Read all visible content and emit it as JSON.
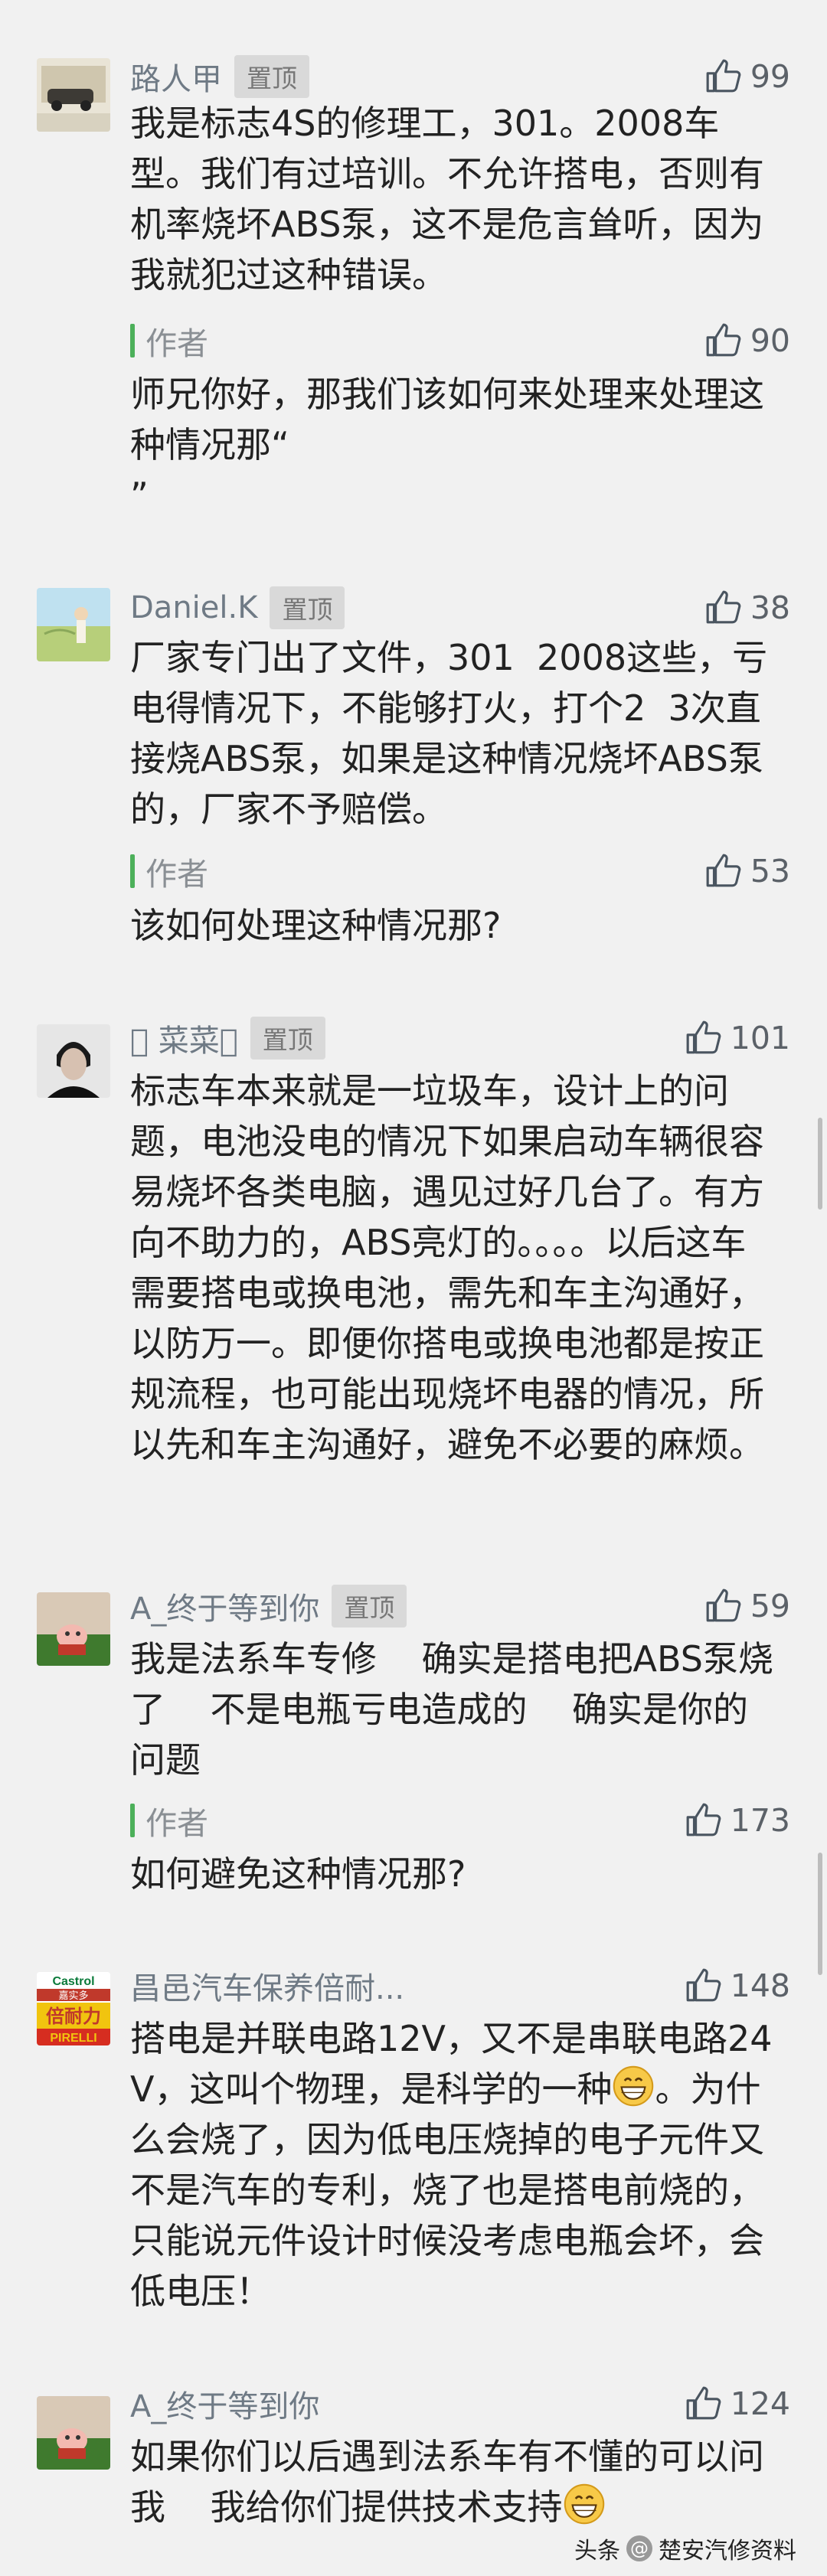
{
  "comments": [
    {
      "username": "路人甲",
      "pinned_label": "置顶",
      "likes": "99",
      "text": "我是标志4S的修理工，301。2008车型。我们有过培训。不允许搭电，否则有机率烧坏ABS泵，这不是危言耸听，因为我就犯过这种错误。",
      "reply": {
        "label": "作者",
        "likes": "90",
        "text": "师兄你好，那我们该如何来处理来处理这种情况那“\n”"
      }
    },
    {
      "username": "Daniel.K",
      "pinned_label": "置顶",
      "likes": "38",
      "text": "厂家专门出了文件，301  2008这些，亏电得情况下，不能够打火，打个2  3次直接烧ABS泵，如果是这种情况烧坏ABS泵的，厂家不予赔偿。",
      "reply": {
        "label": "作者",
        "likes": "53",
        "text": "该如何处理这种情况那?"
      }
    },
    {
      "username": "\u0000 菜菜\u0000",
      "pinned_label": "置顶",
      "likes": "101",
      "text": "标志车本来就是一垃圾车，设计上的问题，电池没电的情况下如果启动车辆很容易烧坏各类电脑，遇见过好几台了。有方向不助力的，ABS亮灯的。。。。以后这车需要搭电或换电池，需先和车主沟通好，以防万一。即便你搭电或换电池都是按正规流程，也可能出现烧坏电器的情况，所以先和车主沟通好，避免不必要的麻烦。"
    },
    {
      "username": "A_终于等到你",
      "pinned_label": "置顶",
      "likes": "59",
      "text": "我是法系车专修    确实是搭电把ABS泵烧了    不是电瓶亏电造成的    确实是你的问题",
      "reply": {
        "label": "作者",
        "likes": "173",
        "text": "如何避免这种情况那?"
      }
    },
    {
      "username": "昌邑汽车保养倍耐...",
      "likes": "148",
      "text_before_emoji": "搭电是并联电路12V，又不是串联电路24V，这叫个物理，是科学的一种",
      "text_after_emoji": "。为什么会烧了，因为低电压烧掉的电子元件又不是汽车的专利，烧了也是搭电前烧的，只能说元件设计时候没考虑电瓶会坏，会低电压！",
      "avatar_text": {
        "brand1": "Castrol",
        "brand2": "嘉实多",
        "brand3": "倍耐力",
        "brand4": "PIRELLI"
      }
    },
    {
      "username": "A_终于等到你",
      "likes": "124",
      "text_before_emoji": "如果你们以后遇到法系车有不懂的可以问我    我给你们提供技术支持",
      "text_after_emoji": ""
    }
  ],
  "watermark": {
    "prefix": "头条",
    "at": "@",
    "account": "楚安汽修资料"
  },
  "colors": {
    "background": "#f1f1f1",
    "username": "#6f7a85",
    "reply_bar": "#4cb05a",
    "badge_bg": "#d9d9d9"
  },
  "icons": {
    "like": "thumbs-up-icon",
    "emoji": "grinning-emoji"
  }
}
